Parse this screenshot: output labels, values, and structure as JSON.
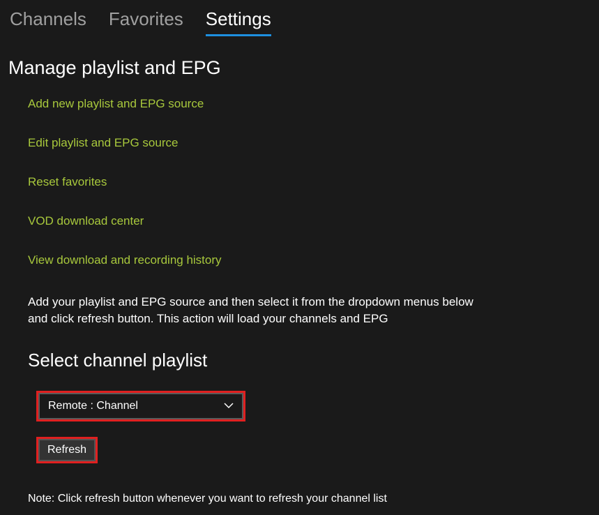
{
  "tabs": {
    "channels": "Channels",
    "favorites": "Favorites",
    "settings": "Settings"
  },
  "section": {
    "title": "Manage playlist and EPG",
    "links": {
      "add": "Add new playlist and EPG source",
      "edit": "Edit playlist and EPG source",
      "reset": "Reset favorites",
      "vod": "VOD download center",
      "history": "View download and recording history"
    },
    "description": "Add your playlist and EPG source and then select it from the dropdown menus below and click refresh button. This action will load your channels and EPG"
  },
  "playlist": {
    "title": "Select channel playlist",
    "selected": "Remote : Channel",
    "refresh_label": "Refresh",
    "note": "Note: Click refresh button whenever you want to refresh your channel list"
  },
  "colors": {
    "link": "#a8c83c",
    "accent": "#1e90e0",
    "highlight": "#e02020"
  }
}
